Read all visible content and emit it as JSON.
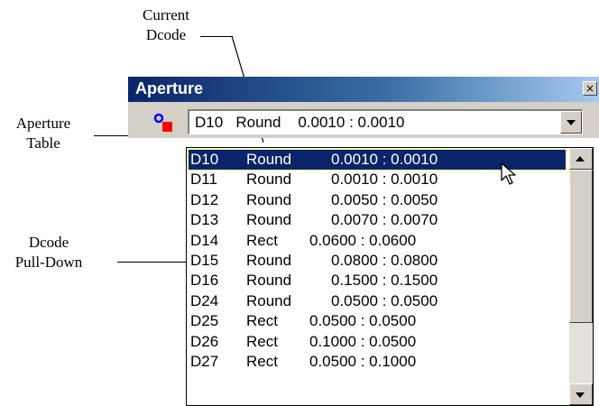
{
  "callouts": {
    "current_dcode": [
      "Current",
      "Dcode"
    ],
    "aperture_table": [
      "Aperture",
      "Table"
    ],
    "dcode_pulldown": [
      "Dcode",
      "Pull-Down"
    ]
  },
  "window": {
    "title": "Aperture",
    "close_label": "×"
  },
  "combo": {
    "selected_text": "D10   Round    0.0010 : 0.0010"
  },
  "list": {
    "selected_index": 0,
    "items": [
      {
        "code": "D10",
        "shape": "Round",
        "size": "0.0010 : 0.0010"
      },
      {
        "code": "D11",
        "shape": "Round",
        "size": "0.0010 : 0.0010"
      },
      {
        "code": "D12",
        "shape": "Round",
        "size": "0.0050 : 0.0050"
      },
      {
        "code": "D13",
        "shape": "Round",
        "size": "0.0070 : 0.0070"
      },
      {
        "code": "D14",
        "shape": "Rect",
        "size": "0.0600 : 0.0600"
      },
      {
        "code": "D15",
        "shape": "Round",
        "size": "0.0800 : 0.0800"
      },
      {
        "code": "D16",
        "shape": "Round",
        "size": "0.1500 : 0.1500"
      },
      {
        "code": "D24",
        "shape": "Round",
        "size": "0.0500 : 0.0500"
      },
      {
        "code": "D25",
        "shape": "Rect",
        "size": "0.0500 : 0.0500"
      },
      {
        "code": "D26",
        "shape": "Rect",
        "size": "0.1000 : 0.0500"
      },
      {
        "code": "D27",
        "shape": "Rect",
        "size": "0.0500 : 0.1000"
      }
    ]
  },
  "icons": {
    "app": "aperture-icon",
    "cursor": "mouse-pointer-icon"
  },
  "colors": {
    "titlebar": "#0a246a",
    "selection": "#0a246a",
    "icon_blue": "#0000ff",
    "icon_red": "#ff0000"
  }
}
